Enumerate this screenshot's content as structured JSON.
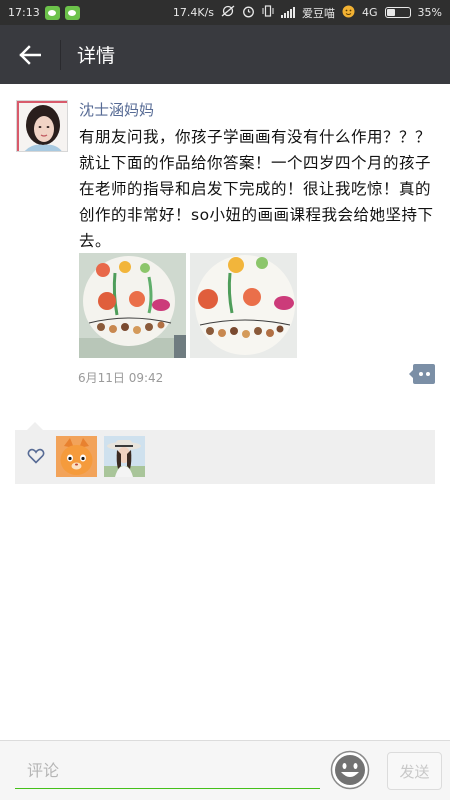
{
  "status_bar": {
    "time": "17:13",
    "net_speed": "17.4K/s",
    "carrier": "爱豆喵",
    "network": "4G",
    "battery": "35%",
    "battery_level": 0.35
  },
  "nav": {
    "title": "详情",
    "back_icon": "arrow-left-icon"
  },
  "moment": {
    "author": "沈士涵妈妈",
    "text": "有朋友问我，你孩子学画画有没有什么作用？？？就让下面的作品给你答案！一个四岁四个月的孩子在老师的指导和启发下完成的！很让我吃惊！真的创作的非常好！so小妞的画画课程我会给她坚持下去。",
    "time": "6月11日 09:42",
    "photo_count": 2,
    "more_icon": "comment-more-icon"
  },
  "likes": {
    "icon": "heart-icon",
    "count": 2
  },
  "comment_bar": {
    "placeholder": "评论",
    "emoji_icon": "smiley-icon",
    "send_label": "发送"
  },
  "colors": {
    "status_bar_bg": "#2f2f2f",
    "nav_bg": "#393a3f",
    "name_blue": "#576b95",
    "input_underline": "#45c01a",
    "likes_bg": "#efefef"
  }
}
